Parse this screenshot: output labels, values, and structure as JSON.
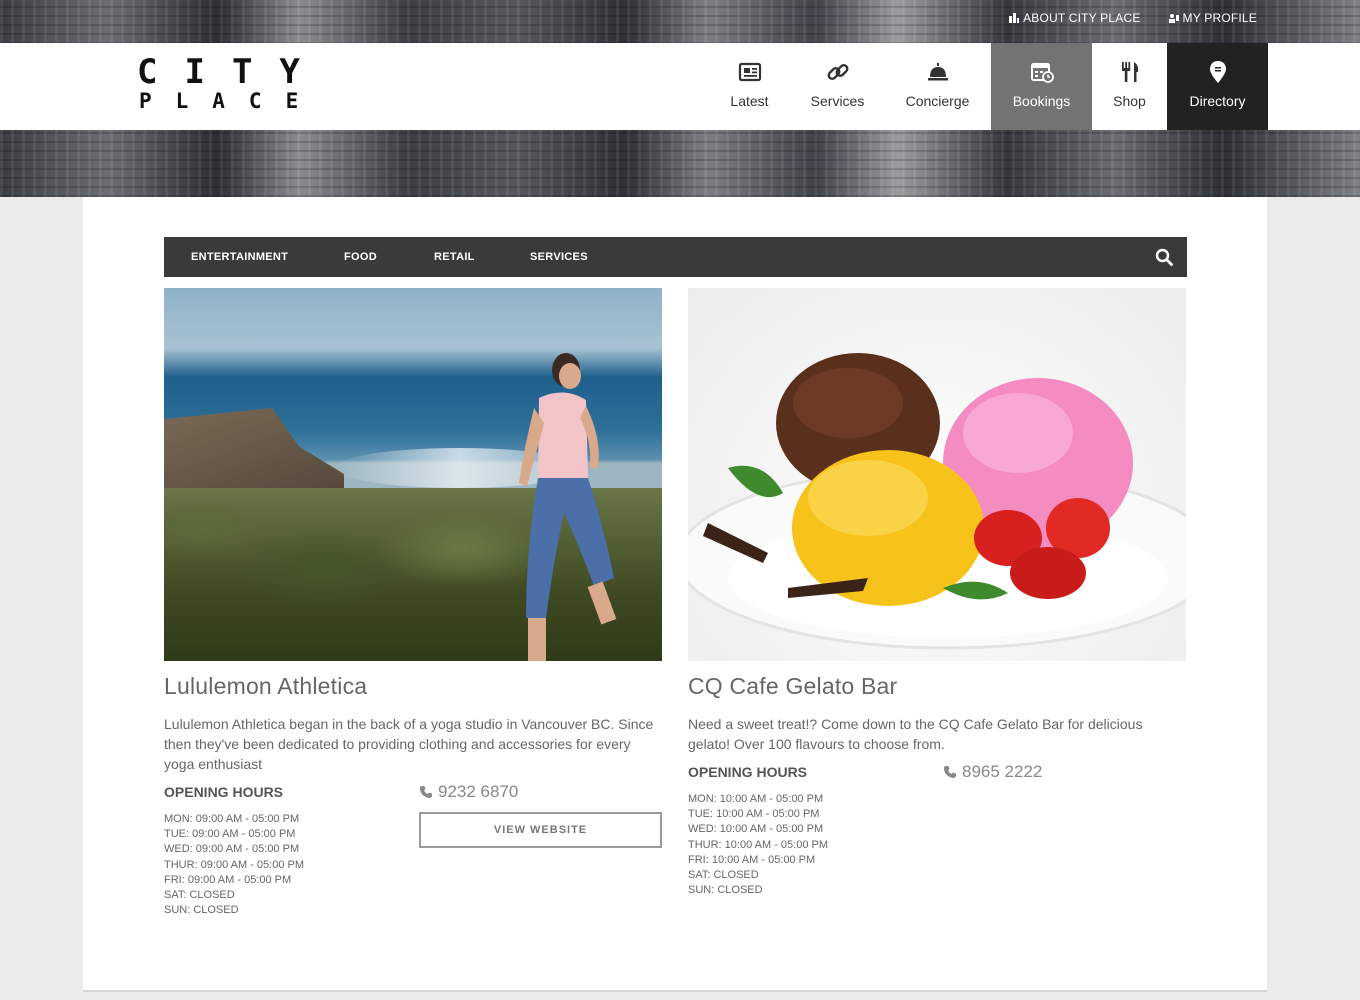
{
  "top_links": [
    {
      "label": "ABOUT CITY PLACE",
      "icon": "city-icon"
    },
    {
      "label": "MY PROFILE",
      "icon": "profile-icon"
    }
  ],
  "logo": {
    "line1": "CITY",
    "line2": "PLACE"
  },
  "nav": [
    {
      "label": "Latest",
      "icon": "newspaper-icon"
    },
    {
      "label": "Services",
      "icon": "link-icon"
    },
    {
      "label": "Concierge",
      "icon": "concierge-bell-icon"
    },
    {
      "label": "Bookings",
      "icon": "calendar-clock-icon"
    },
    {
      "label": "Shop",
      "icon": "fork-knife-icon"
    },
    {
      "label": "Directory",
      "icon": "map-pin-icon"
    }
  ],
  "categories": [
    "ENTERTAINMENT",
    "FOOD",
    "RETAIL",
    "SERVICES"
  ],
  "colors": {
    "nav_active": "#737373",
    "nav_dark": "#222222",
    "category_bar": "#3a3a3a"
  },
  "listings": [
    {
      "title": "Lululemon Athletica",
      "description": "Lululemon Athletica began in the back of a yoga studio in Vancouver BC. Since then they've been dedicated to providing clothing and accessories for every yoga enthusiast",
      "opening_hours_title": "OPENING HOURS",
      "hours": [
        "MON: 09:00 AM - 05:00 PM",
        "TUE: 09:00 AM - 05:00 PM",
        "WED: 09:00 AM - 05:00 PM",
        "THUR: 09:00 AM - 05:00 PM",
        "FRI: 09:00 AM - 05:00 PM",
        "SAT: CLOSED",
        "SUN: CLOSED"
      ],
      "phone": "9232 6870",
      "website_button": "VIEW WEBSITE"
    },
    {
      "title": "CQ Cafe Gelato Bar",
      "description": "Need a sweet treat!? Come down to the CQ Cafe Gelato Bar for delicious gelato! Over 100 flavours to choose from.",
      "opening_hours_title": "OPENING HOURS",
      "hours": [
        "MON: 10:00 AM - 05:00 PM",
        "TUE: 10:00 AM - 05:00 PM",
        "WED: 10:00 AM - 05:00 PM",
        "THUR: 10:00 AM - 05:00 PM",
        "FRI: 10:00 AM - 05:00 PM",
        "SAT: CLOSED",
        "SUN: CLOSED"
      ],
      "phone": "8965 2222"
    }
  ]
}
